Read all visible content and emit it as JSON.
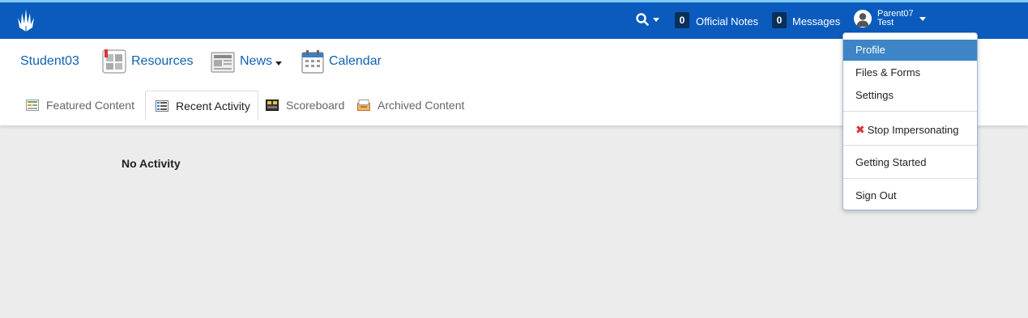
{
  "topbar": {
    "search_icon": "search-icon",
    "notes_count": "0",
    "notes_label": "Official Notes",
    "messages_count": "0",
    "messages_label": "Messages",
    "user_first_line": "Parent07",
    "user_second_line": "Test"
  },
  "nav": {
    "student": "Student03",
    "resources": "Resources",
    "news": "News",
    "calendar": "Calendar"
  },
  "subtabs": [
    {
      "label": "Featured Content",
      "icon": "featured-content-icon"
    },
    {
      "label": "Recent Activity",
      "icon": "recent-activity-icon",
      "active": true
    },
    {
      "label": "Scoreboard",
      "icon": "scoreboard-icon"
    },
    {
      "label": "Archived Content",
      "icon": "archived-content-icon"
    }
  ],
  "main": {
    "empty_message": "No Activity"
  },
  "user_menu": {
    "items": [
      {
        "label": "Profile",
        "active": true
      },
      {
        "label": "Files & Forms"
      },
      {
        "label": "Settings"
      },
      {
        "label": "Stop Impersonating",
        "icon": "close-x-icon"
      },
      {
        "label": "Getting Started"
      },
      {
        "label": "Sign Out"
      }
    ]
  },
  "colors": {
    "topbar": "#0a5bbd",
    "link": "#1262b3",
    "menu_active": "#3d85c6",
    "badge": "#0b2f58"
  }
}
